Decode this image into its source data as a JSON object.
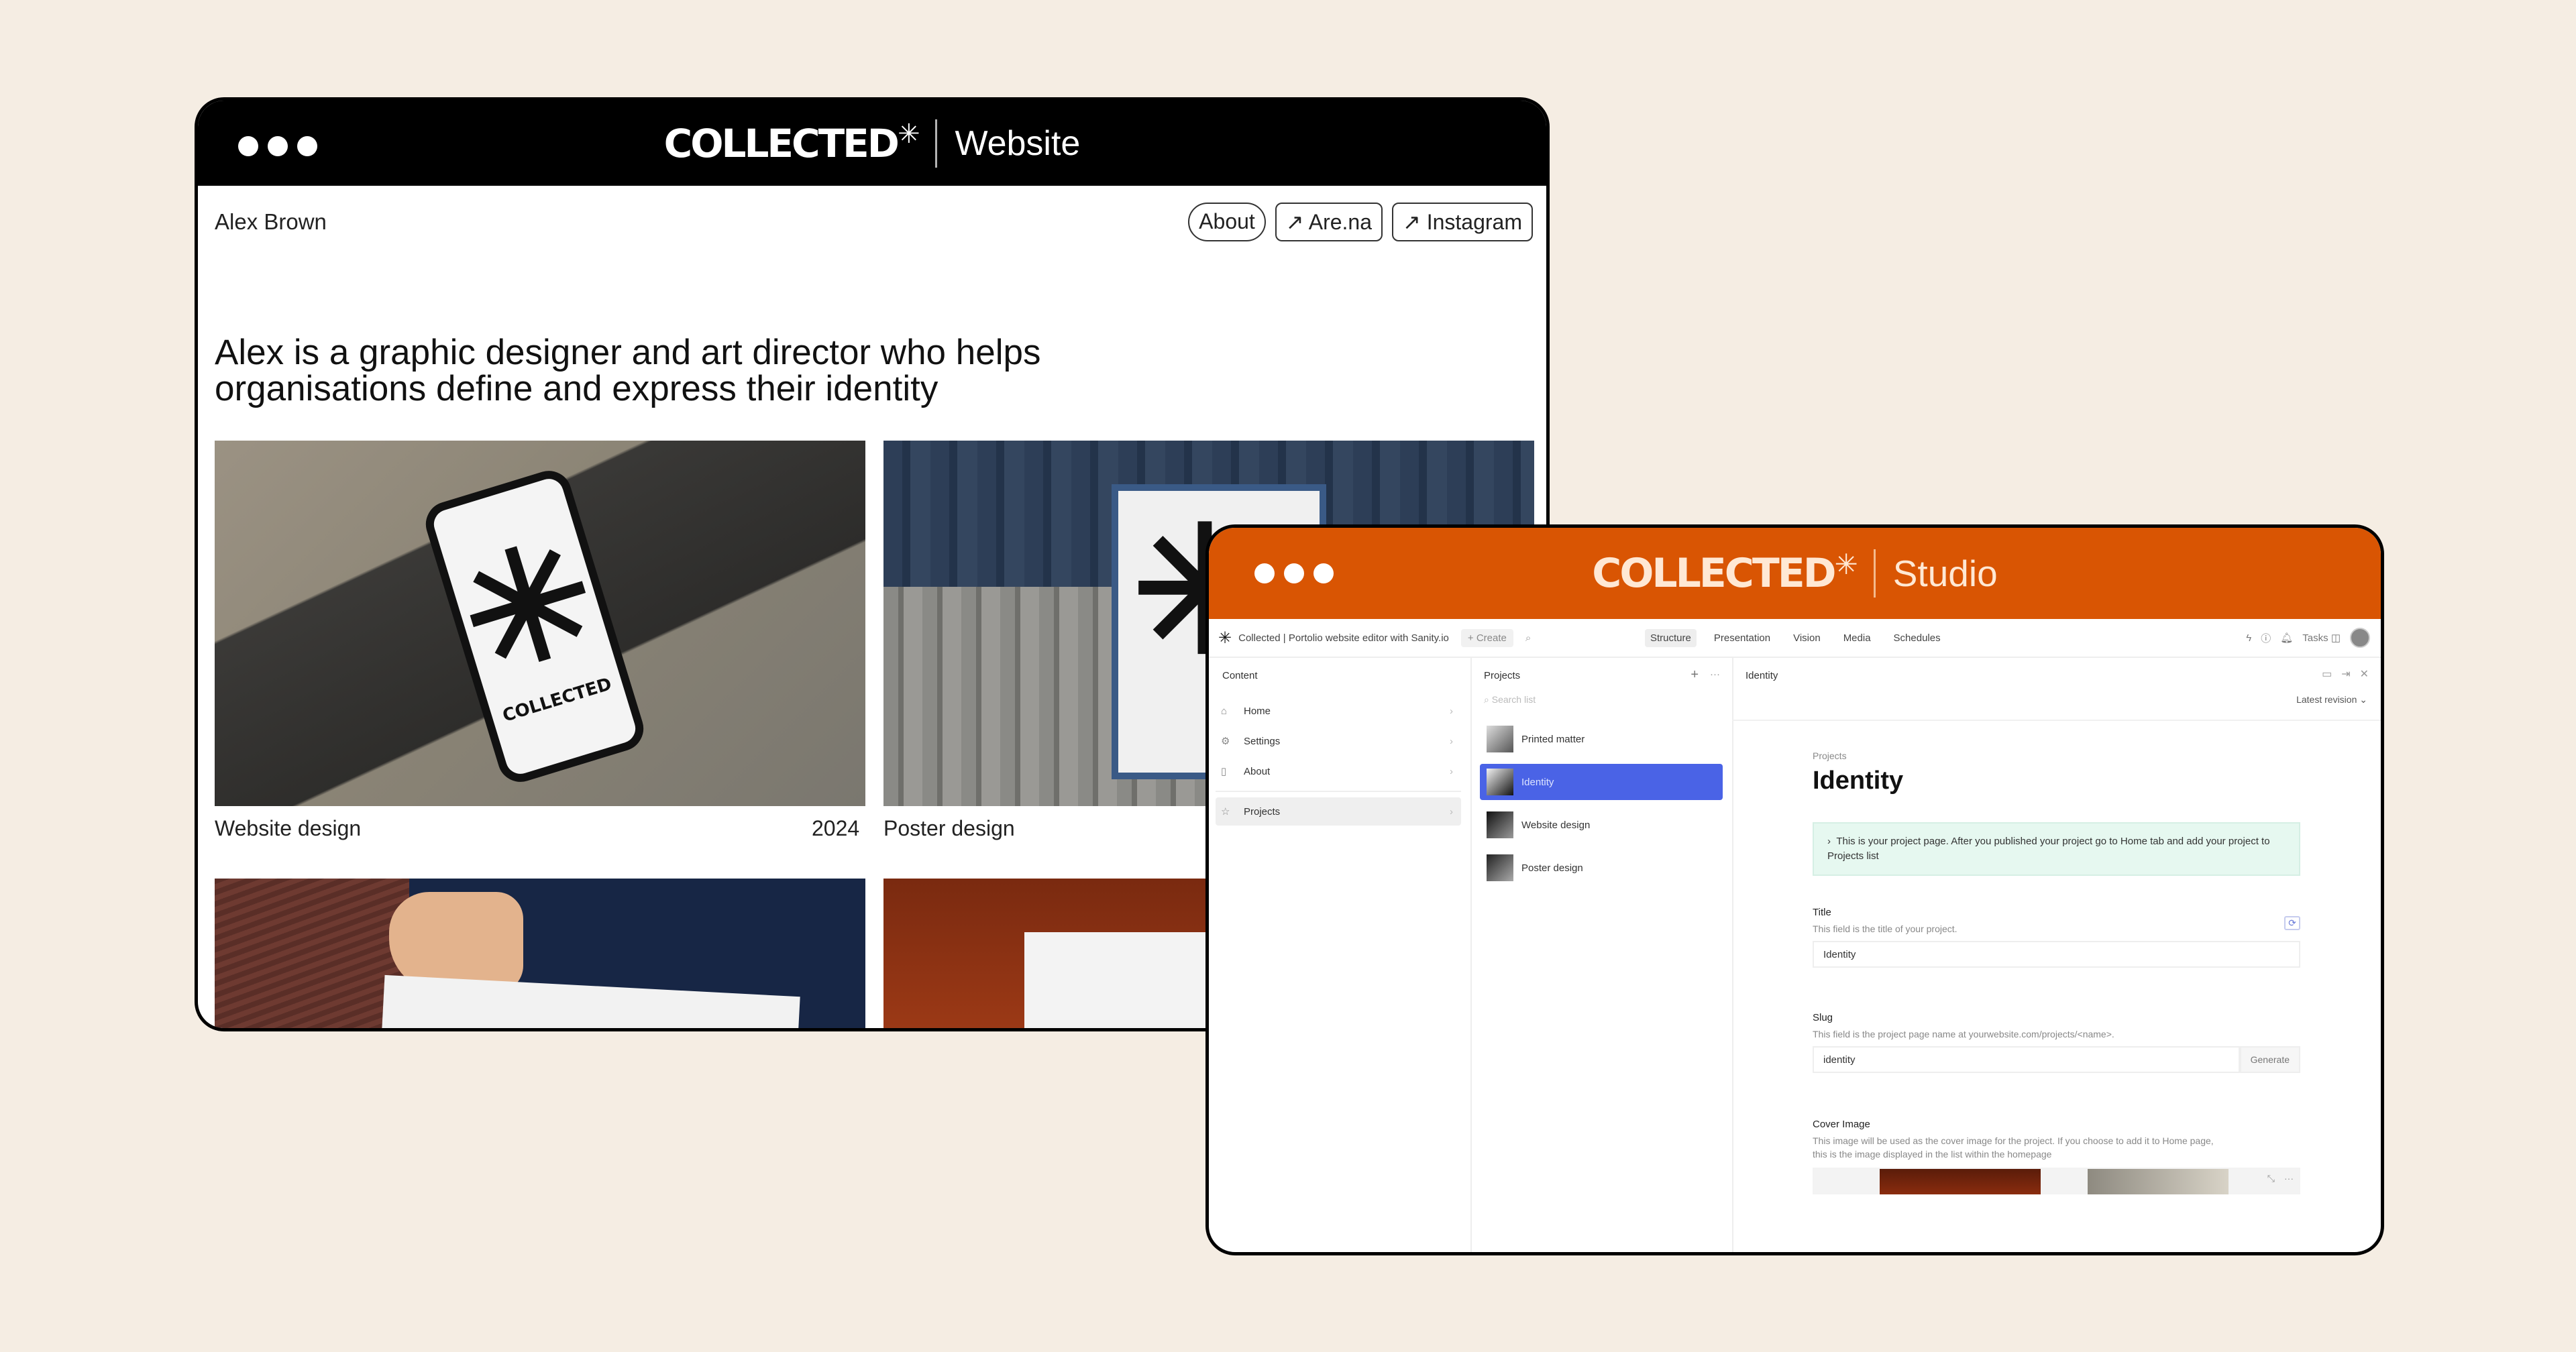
{
  "website_window": {
    "brand": "COLLECTED",
    "brand_mark": "✳",
    "label": "Website",
    "owner_name": "Alex Brown",
    "nav": [
      {
        "label": "About",
        "icon": ""
      },
      {
        "label": "Are.na",
        "icon": "↗"
      },
      {
        "label": "Instagram",
        "icon": "↗"
      }
    ],
    "intro": "Alex is a graphic designer and art director who helps organisations define and express their identity",
    "projects": [
      {
        "title": "Website design",
        "year": "2024"
      },
      {
        "title": "Poster design",
        "year": ""
      }
    ],
    "card_mockup_text": "COLLECTED"
  },
  "studio_window": {
    "brand": "COLLECTED",
    "brand_mark": "✳",
    "label": "Studio",
    "topbar": {
      "logo_icon": "✳",
      "title": "Collected | Portolio website editor with Sanity.io",
      "create": "+ Create",
      "search_icon": "⌕",
      "tabs": [
        "Structure",
        "Presentation",
        "Vision",
        "Media",
        "Schedules"
      ],
      "active_tab": "Structure",
      "tasks": "Tasks",
      "icons": [
        "bolt",
        "help",
        "bell"
      ]
    },
    "content_pane": {
      "title": "Content",
      "items": [
        {
          "label": "Home",
          "icon": "⌂"
        },
        {
          "label": "Settings",
          "icon": "⚙"
        },
        {
          "label": "About",
          "icon": "▯"
        },
        {
          "label": "Projects",
          "icon": "☆"
        }
      ],
      "active": "Projects"
    },
    "projects_pane": {
      "title": "Projects",
      "add_icon": "+",
      "menu_icon": "···",
      "search_placeholder": "Search list",
      "items": [
        "Printed matter",
        "Identity",
        "Website design",
        "Poster design"
      ],
      "selected": "Identity"
    },
    "document_pane": {
      "header_title": "Identity",
      "revision": "Latest revision",
      "breadcrumb": "Projects",
      "title": "Identity",
      "callout": "This is your project page. After you published your project go to Home tab and add your project to Projects list",
      "fields": {
        "title": {
          "label": "Title",
          "description": "This field is the title of your project.",
          "value": "Identity"
        },
        "slug": {
          "label": "Slug",
          "description": "This field is the project page name at yourwebsite.com/projects/<name>.",
          "value": "identity",
          "button": "Generate"
        },
        "cover": {
          "label": "Cover Image",
          "description": "This image will be used as the cover image for the project. If you choose to add it to Home page, this is the image displayed in the list within the homepage"
        }
      }
    }
  },
  "colors": {
    "background": "#f5ede3",
    "studio_accent": "#d95503",
    "selection_blue": "#4a63e6",
    "callout_green": "#e6f8f0"
  }
}
